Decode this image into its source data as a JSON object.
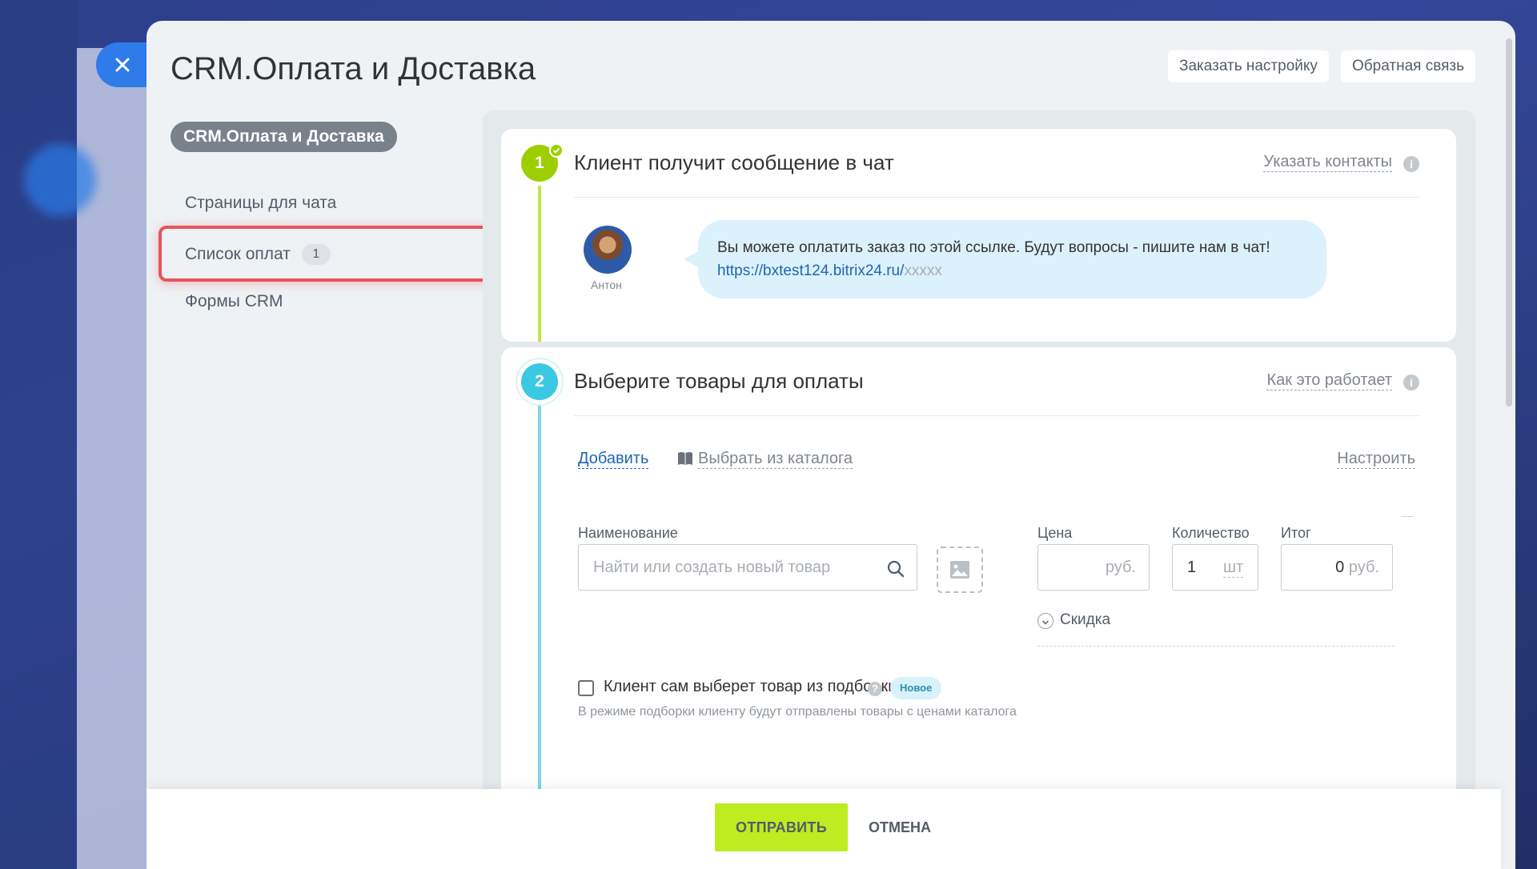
{
  "header": {
    "title": "CRM.Оплата и Доставка",
    "order_setup": "Заказать настройку",
    "feedback": "Обратная связь"
  },
  "menu": {
    "active": "CRM.Оплата и Доставка",
    "items": [
      {
        "label": "Страницы для чата"
      },
      {
        "label": "Список оплат",
        "count": "1"
      },
      {
        "label": "Формы CRM"
      }
    ]
  },
  "step1": {
    "number": "1",
    "title": "Клиент получит сообщение в чат",
    "link": "Указать контакты",
    "author": "Антон",
    "message_text": "Вы можете оплатить заказ по этой ссылке. Будут вопросы - пишите нам в чат! ",
    "message_link": "https://bxtest124.bitrix24.ru/",
    "message_mask": "xxxxx"
  },
  "step2": {
    "number": "2",
    "title": "Выберите товары для оплаты",
    "link": "Как это работает",
    "add": "Добавить",
    "catalog": "Выбрать из каталога",
    "settings": "Настроить",
    "labels": {
      "name": "Наименование",
      "price": "Цена",
      "qty": "Количество",
      "total": "Итог"
    },
    "name_placeholder": "Найти или создать новый товар",
    "price_unit": "руб.",
    "qty_value": "1",
    "qty_unit": "шт",
    "total_value": "0",
    "total_unit": "руб.",
    "discount": "Скидка",
    "client_choice": "Клиент сам выберет товар из подборки",
    "new_badge": "Новое",
    "hint": "В режиме подборки клиенту будут отправлены товары с ценами каталога"
  },
  "footer": {
    "send": "ОТПРАВИТЬ",
    "cancel": "ОТМЕНА"
  },
  "colors": {
    "accent": "#2f7bea",
    "step1": "#9dcf00",
    "step2": "#3bc8e2",
    "send_button": "#bbed21",
    "highlight": "#e9535a"
  },
  "icons": [
    "close-icon",
    "check-icon",
    "info-icon",
    "book-icon",
    "search-icon",
    "image-icon",
    "chevron-down-icon",
    "question-icon"
  ]
}
